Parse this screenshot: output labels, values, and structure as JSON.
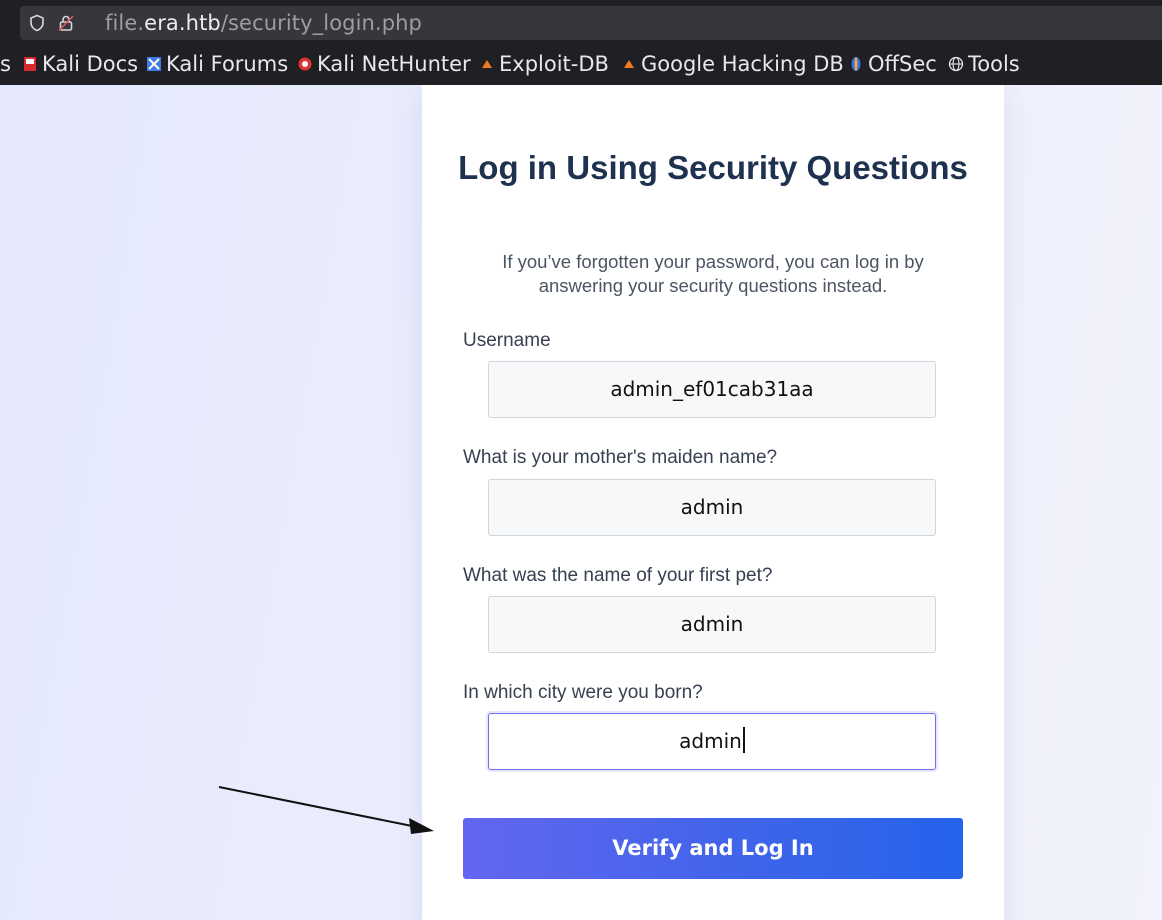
{
  "browser": {
    "url": {
      "scheme_sub": "file.",
      "host": "era.htb",
      "path": "/security_login.php"
    },
    "bookmarks": [
      {
        "label": "s",
        "icon": "overflow-icon"
      },
      {
        "label": "Kali Docs",
        "icon": "kali-docs-icon"
      },
      {
        "label": "Kali Forums",
        "icon": "kali-forums-icon"
      },
      {
        "label": "Kali NetHunter",
        "icon": "kali-nethunter-icon"
      },
      {
        "label": "Exploit-DB",
        "icon": "exploit-db-icon"
      },
      {
        "label": "Google Hacking DB",
        "icon": "google-hacking-db-icon"
      },
      {
        "label": "OffSec",
        "icon": "offsec-icon"
      },
      {
        "label": "Tools",
        "icon": "globe-icon"
      }
    ]
  },
  "form": {
    "title": "Log in Using Security Questions",
    "subtitle": "If you’ve forgotten your password, you can log in by answering your security questions instead.",
    "fields": [
      {
        "label": "Username",
        "value": "admin_ef01cab31aa"
      },
      {
        "label": "What is your mother's maiden name?",
        "value": "admin"
      },
      {
        "label": "What was the name of your first pet?",
        "value": "admin"
      },
      {
        "label": "In which city were you born?",
        "value": "admin"
      }
    ],
    "submit_label": "Verify and Log In"
  },
  "colors": {
    "title": "#1e3250",
    "button_start": "#6366f1",
    "button_end": "#2563eb",
    "focus_ring": "#6c6ff0"
  }
}
